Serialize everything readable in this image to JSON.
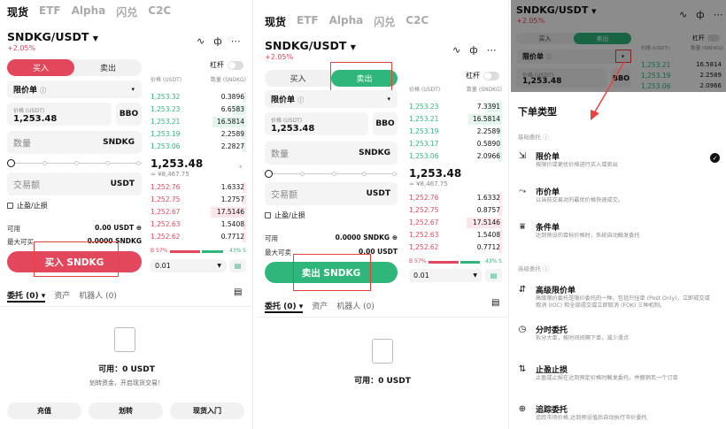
{
  "nav": {
    "tabs": [
      "现货",
      "ETF",
      "Alpha",
      "闪兑",
      "C2C"
    ]
  },
  "pair": {
    "name": "SNDKG/USDT",
    "change": "+2.05%"
  },
  "toggle": {
    "label": "杠杆"
  },
  "sides": {
    "buy": "买入",
    "sell": "卖出"
  },
  "order_form": {
    "order_type": "限价单",
    "price_label": "价格 (USDT)",
    "price_value": "1,253.48",
    "bbo": "BBO",
    "qty_placeholder": "数量",
    "qty_unit": "SNDKG",
    "amount_placeholder": "交易额",
    "amount_unit": "USDT",
    "tpsl": "止盈/止损"
  },
  "buy_panel": {
    "avail_label": "可用",
    "avail_value": "0.00 USDT",
    "max_label": "最大可买",
    "max_value": "0.0000 SNDKG",
    "button": "买入 SNDKG"
  },
  "sell_panel": {
    "avail_label": "可用",
    "avail_value": "0.0000 SNDKG",
    "max_label": "最大可卖",
    "max_value": "0.00 USDT",
    "button": "卖出 SNDKG"
  },
  "orderbook": {
    "col_price": "价格 (USDT)",
    "col_qty": "数量 (SNDKG)",
    "asks_p1": [
      {
        "price": "1,253.32",
        "qty": "0.3896"
      },
      {
        "price": "1,253.23",
        "qty": "6.6583"
      },
      {
        "price": "1,253.21",
        "qty": "16.5814"
      },
      {
        "price": "1,253.19",
        "qty": "2.2589"
      },
      {
        "price": "1,253.06",
        "qty": "2.2827"
      }
    ],
    "asks_p2": [
      {
        "price": "1,253.23",
        "qty": "7.3391"
      },
      {
        "price": "1,253.21",
        "qty": "16.5814"
      },
      {
        "price": "1,253.19",
        "qty": "2.2589"
      },
      {
        "price": "1,253.17",
        "qty": "0.5890"
      },
      {
        "price": "1,253.06",
        "qty": "2.0966"
      }
    ],
    "last_price": "1,253.48",
    "last_fiat": "≈ ¥8,467.75",
    "bids_p1": [
      {
        "price": "1,252.76",
        "qty": "1.6332"
      },
      {
        "price": "1,252.75",
        "qty": "1.2757"
      },
      {
        "price": "1,252.67",
        "qty": "17.5146"
      },
      {
        "price": "1,252.63",
        "qty": "1.5408"
      },
      {
        "price": "1,252.62",
        "qty": "0.7712"
      }
    ],
    "bids_p2": [
      {
        "price": "1,252.76",
        "qty": "1.6332"
      },
      {
        "price": "1,252.75",
        "qty": "0.8757"
      },
      {
        "price": "1,252.67",
        "qty": "17.5146"
      },
      {
        "price": "1,252.63",
        "qty": "1.5408"
      },
      {
        "price": "1,252.62",
        "qty": "0.7712"
      }
    ],
    "ratio_left": "B 57%",
    "ratio_right": "43% S",
    "ratio_buy_fraction": 0.57,
    "precision": "0.01"
  },
  "bottom_tabs": [
    "委托 (0) ▾",
    "资产",
    "机器人 (0)"
  ],
  "empty": {
    "avail": "可用：0 USDT",
    "hint": "划转资金，开启现货交易！"
  },
  "bottom_buttons": [
    "充值",
    "划转",
    "现货入门"
  ],
  "sheet": {
    "title": "下单类型",
    "basic_label": "基础委托",
    "advanced_label": "高级委托",
    "basic": [
      {
        "title": "限价单",
        "desc": "按限价或更优价格进行买入或卖出",
        "icon": "limit-icon"
      },
      {
        "title": "市价单",
        "desc": "以当前交易对的最优价格快速成交。",
        "icon": "market-icon"
      },
      {
        "title": "条件单",
        "desc": "达到预设的目标价格时，系统自动触发委托",
        "icon": "conditional-icon"
      }
    ],
    "advanced": [
      {
        "title": "高级限价单",
        "desc": "高级限价委托是限价委托的一种，包括只挂单 (Post Only)，立即成交或取消 (IOC) 和全部成交或立即取消 (FOK) 三种机制。",
        "icon": "advanced-limit-icon"
      },
      {
        "title": "分时委托",
        "desc": "拆分大单，按时间间隔下单，减少滑点",
        "icon": "clock-icon"
      },
      {
        "title": "止盈止损",
        "desc": "止盈或止损在达到预定价格时触发委托，并撤销另一个订单",
        "icon": "tpsl-icon"
      },
      {
        "title": "追踪委托",
        "desc": "追踪市场价格,达到预设值后自动执行市价委托",
        "icon": "trailing-icon"
      }
    ]
  }
}
